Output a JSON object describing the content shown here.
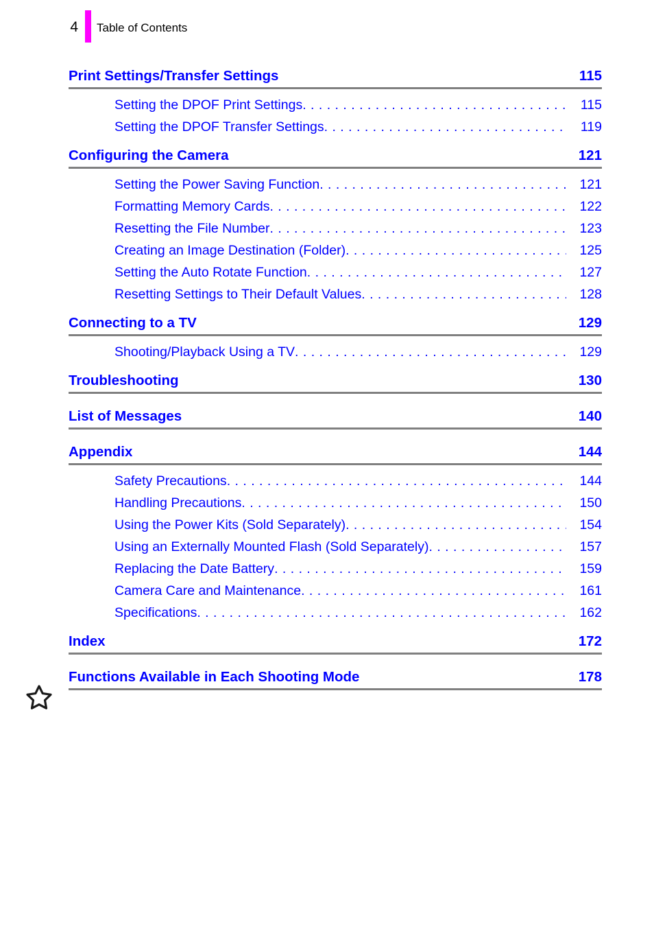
{
  "header": {
    "folio": "4",
    "title": "Table of Contents",
    "rule_color": "#ff00ff"
  },
  "theme": {
    "link_color": "#0000ff",
    "divider_color": "#808080",
    "text_color": "#000000",
    "background": "#ffffff"
  },
  "marker": {
    "icon": "star-outline-icon"
  },
  "toc": {
    "sections": [
      {
        "title": "Print Settings/Transfer Settings",
        "page": "115",
        "entries": [
          {
            "title": "Setting the DPOF Print Settings",
            "page": "115"
          },
          {
            "title": "Setting the DPOF Transfer Settings",
            "page": "119"
          }
        ]
      },
      {
        "title": "Configuring the Camera",
        "page": "121",
        "entries": [
          {
            "title": "Setting the Power Saving Function",
            "page": "121"
          },
          {
            "title": "Formatting Memory Cards",
            "page": "122"
          },
          {
            "title": "Resetting the File Number",
            "page": "123"
          },
          {
            "title": "Creating an Image Destination (Folder)",
            "page": "125"
          },
          {
            "title": "Setting the Auto Rotate Function",
            "page": "127"
          },
          {
            "title": "Resetting Settings to Their Default Values",
            "page": "128"
          }
        ]
      },
      {
        "title": "Connecting to a TV",
        "page": "129",
        "entries": [
          {
            "title": "Shooting/Playback Using a TV",
            "page": "129"
          }
        ]
      },
      {
        "title": "Troubleshooting",
        "page": "130",
        "entries": []
      },
      {
        "title": "List of Messages",
        "page": "140",
        "entries": []
      },
      {
        "title": "Appendix",
        "page": "144",
        "entries": [
          {
            "title": "Safety Precautions",
            "page": "144"
          },
          {
            "title": "Handling Precautions",
            "page": "150"
          },
          {
            "title": "Using the Power Kits (Sold Separately)",
            "page": "154"
          },
          {
            "title": "Using an Externally Mounted Flash (Sold Separately)",
            "page": "157"
          },
          {
            "title": "Replacing the Date Battery",
            "page": "159"
          },
          {
            "title": "Camera Care and Maintenance",
            "page": "161"
          },
          {
            "title": "Specifications",
            "page": "162"
          }
        ]
      },
      {
        "title": "Index",
        "page": "172",
        "entries": []
      },
      {
        "title": "Functions Available in Each Shooting Mode",
        "page": "178",
        "entries": []
      }
    ]
  }
}
